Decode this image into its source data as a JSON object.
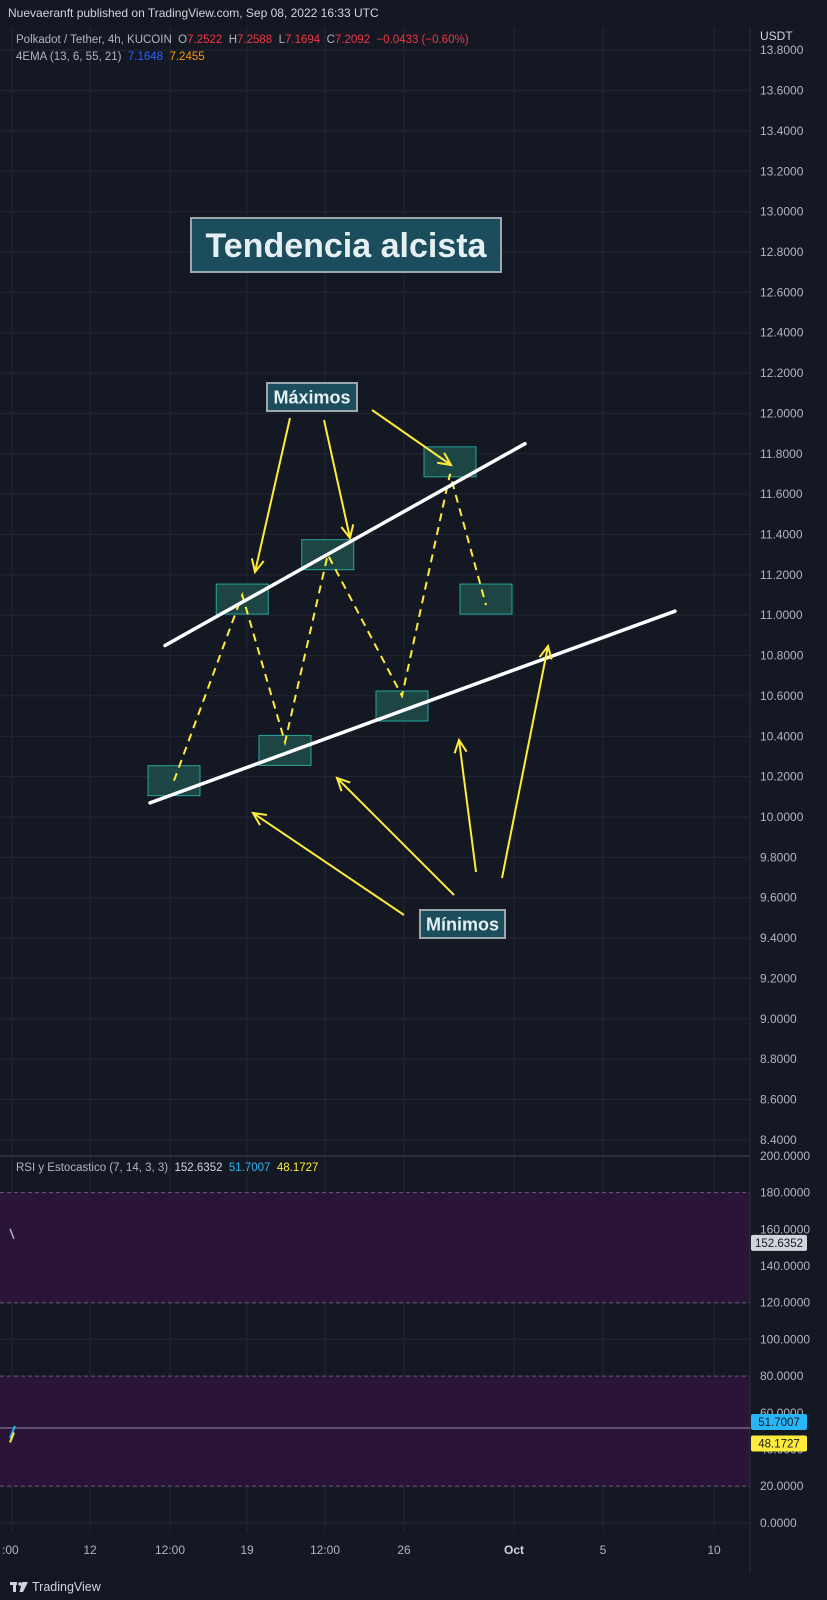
{
  "header": {
    "published": "Nuevaeranft published on TradingView.com, Sep 08, 2022 16:33 UTC"
  },
  "legend": {
    "symbol": "Polkadot / Tether, 4h, KUCOIN",
    "o_label": "O",
    "o_value": "7.2522",
    "h_label": "H",
    "h_value": "7.2588",
    "l_label": "L",
    "l_value": "7.1694",
    "c_label": "C",
    "c_value": "7.2092",
    "change": "−0.0433 (−0.60%)",
    "ema_label": "4EMA (13, 6, 55, 21)",
    "ema_value1": "7.1648",
    "ema_value2": "7.2455"
  },
  "rsi_legend": {
    "label": "RSI y Estocastico (7, 14, 3, 3)",
    "v1": "152.6352",
    "v2": "51.7007",
    "v3": "48.1727"
  },
  "footer": {
    "brand": "TradingView"
  },
  "colors": {
    "bg": "#141823",
    "grid": "#202634",
    "annotation": "#ffeb3b",
    "trendline": "#ffffff",
    "box_fill": "#1e4d4a",
    "box_stroke": "#26a69a",
    "label_fill": "#1b4d5c",
    "rsi_band": "#2a1538",
    "rsi_value": "#b2b5be",
    "k_line": "#29b6f6",
    "d_line": "#ffeb3b"
  },
  "chart_data": [
    {
      "type": "line",
      "pane": "price",
      "currency": "USDT",
      "x_ticks": [
        "12:00",
        "19",
        "12:00",
        "26",
        "Oct",
        "5",
        "10"
      ],
      "x_tick_edge": ":00",
      "x_tick_before": "12",
      "ylim": [
        8.32,
        13.92
      ],
      "y_ticks": [
        13.8,
        13.6,
        13.4,
        13.2,
        13.0,
        12.8,
        12.6,
        12.4,
        12.2,
        12.0,
        11.8,
        11.6,
        11.4,
        11.2,
        11.0,
        10.8,
        10.6,
        10.4,
        10.2,
        10.0,
        9.8,
        9.6,
        9.4,
        9.2,
        9.0,
        8.8,
        8.6,
        8.4
      ],
      "annotations": {
        "title": "Tendencia alcista",
        "maxima_label": "Máximos",
        "minima_label": "Mínimos",
        "swing_path": [
          {
            "x": 0.232,
            "y": 10.18
          },
          {
            "x": 0.323,
            "y": 11.1
          },
          {
            "x": 0.38,
            "y": 10.37
          },
          {
            "x": 0.437,
            "y": 11.3
          },
          {
            "x": 0.536,
            "y": 10.6
          },
          {
            "x": 0.6,
            "y": 11.7
          },
          {
            "x": 0.648,
            "y": 11.05
          }
        ],
        "swing_boxes": [
          {
            "x": 0.232,
            "y": 10.18,
            "kind": "min"
          },
          {
            "x": 0.323,
            "y": 11.08,
            "kind": "max"
          },
          {
            "x": 0.38,
            "y": 10.33,
            "kind": "min"
          },
          {
            "x": 0.437,
            "y": 11.3,
            "kind": "max"
          },
          {
            "x": 0.536,
            "y": 10.55,
            "kind": "min"
          },
          {
            "x": 0.6,
            "y": 11.76,
            "kind": "max"
          },
          {
            "x": 0.648,
            "y": 11.08,
            "kind": "max"
          }
        ],
        "resistance_line": [
          {
            "x": 0.22,
            "y": 10.85
          },
          {
            "x": 0.7,
            "y": 11.85
          }
        ],
        "support_line": [
          {
            "x": 0.2,
            "y": 10.07
          },
          {
            "x": 0.9,
            "y": 11.02
          }
        ]
      }
    },
    {
      "type": "line",
      "pane": "oscillator",
      "ylim": [
        -5,
        200
      ],
      "y_ticks": [
        200,
        180,
        160,
        140,
        120,
        100,
        80,
        60,
        40,
        20,
        0
      ],
      "bands": [
        [
          120,
          180
        ],
        [
          20,
          80
        ]
      ],
      "series": [
        {
          "value": 152.6352,
          "color": "#b2b5be"
        },
        {
          "value": 51.7007,
          "color": "#29b6f6"
        },
        {
          "value": 48.1727,
          "color": "#ffeb3b"
        }
      ]
    }
  ]
}
